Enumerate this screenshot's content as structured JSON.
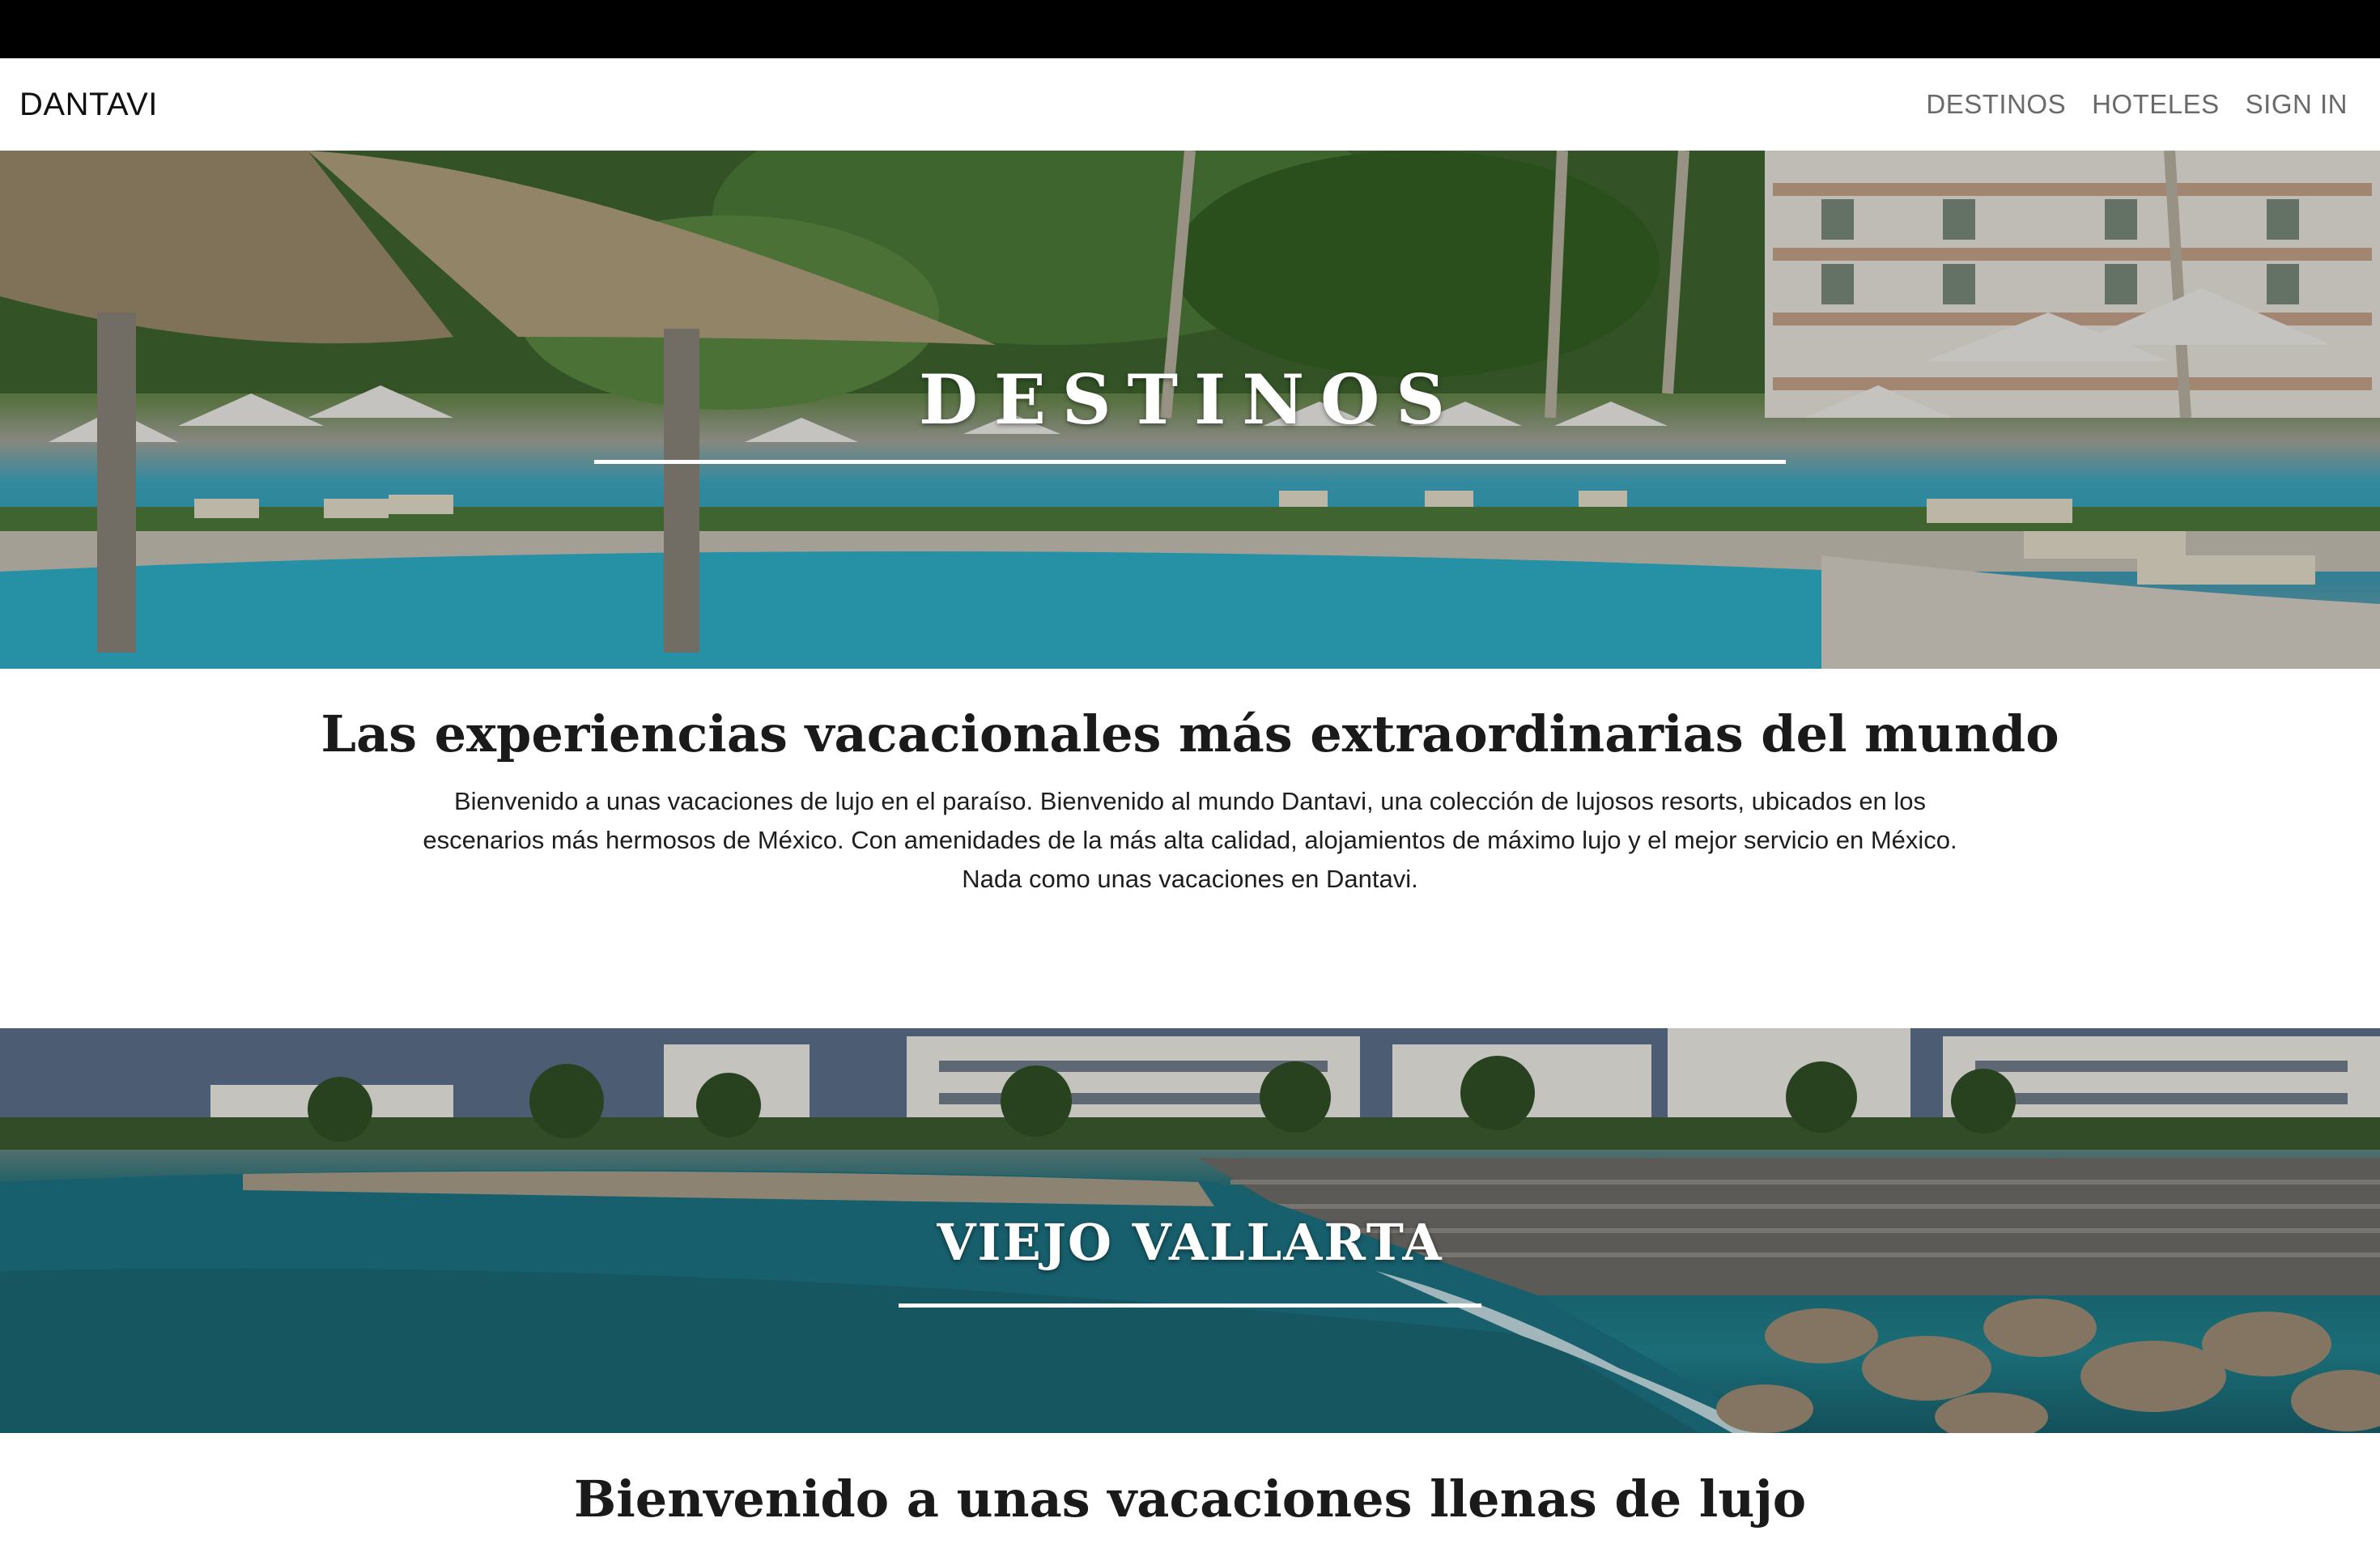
{
  "nav": {
    "brand": "DANTAVI",
    "links": [
      "DESTINOS",
      "HOTELES",
      "SIGN IN"
    ]
  },
  "hero": {
    "title": "DESTINOS"
  },
  "intro": {
    "heading": "Las experiencias vacacionales más extraordinarias del mundo",
    "text": "Bienvenido a unas vacaciones de lujo en el paraíso. Bienvenido al mundo Dantavi, una colección de lujosos resorts, ubicados en los escenarios más hermosos de México. Con amenidades de la más alta calidad, alojamientos de máximo lujo y el mejor servicio en México. Nada como unas vacaciones en Dantavi."
  },
  "destination": {
    "title": "VIEJO VALLARTA"
  },
  "section": {
    "heading": "Bienvenido a unas vacaciones llenas de lujo"
  }
}
